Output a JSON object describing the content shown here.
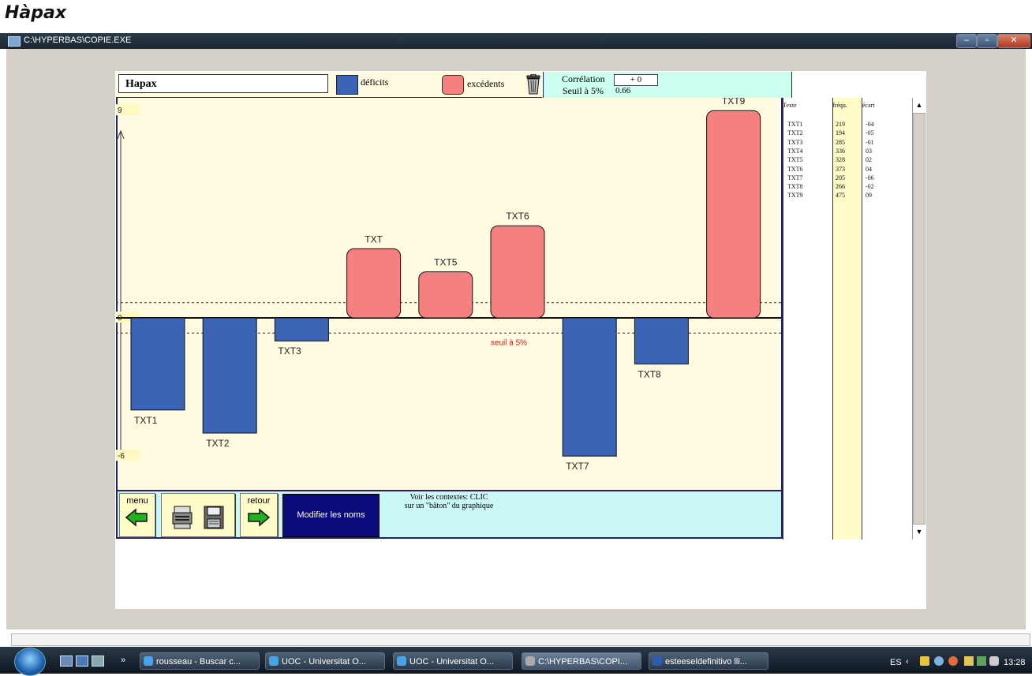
{
  "page_heading": "Hàpax",
  "window": {
    "title": "C:\\HYPERBAS\\COPIE.EXE"
  },
  "header": {
    "name_field": "Hapax",
    "legend_deficit": "déficits",
    "legend_excedent": "excédents",
    "correlation_label": "Corrélation",
    "correlation_value": "+ 0",
    "seuil_label": "Seuil à 5%",
    "seuil_value": "0.66"
  },
  "chart_data": {
    "type": "bar",
    "ylim": [
      -6,
      9
    ],
    "ytick_labels": [
      "9",
      "0",
      "-6"
    ],
    "threshold": 0.66,
    "threshold_label": "seuil à 5%",
    "bars": [
      {
        "label": "TXT1",
        "value": -4
      },
      {
        "label": "TXT2",
        "value": -5
      },
      {
        "label": "TXT3",
        "value": -1
      },
      {
        "label": "TXT",
        "value": 3
      },
      {
        "label": "TXT5",
        "value": 2
      },
      {
        "label": "TXT6",
        "value": 4
      },
      {
        "label": "TXT7",
        "value": -6
      },
      {
        "label": "TXT8",
        "value": -2
      },
      {
        "label": "TXT9",
        "value": 9
      }
    ],
    "colors": {
      "deficit": "#3b64b6",
      "excedent": "#f58080"
    }
  },
  "table": {
    "headers": [
      "Texte",
      "fréqu.",
      "écart"
    ],
    "rows": [
      [
        "TXT1",
        "219",
        "-04"
      ],
      [
        "TXT2",
        "194",
        "-05"
      ],
      [
        "TXT3",
        "285",
        "-01"
      ],
      [
        "TXT4",
        "336",
        "03"
      ],
      [
        "TXT5",
        "328",
        "02"
      ],
      [
        "TXT6",
        "373",
        "04"
      ],
      [
        "TXT7",
        "205",
        "-06"
      ],
      [
        "TXT8",
        "266",
        "-02"
      ],
      [
        "TXT9",
        "475",
        "09"
      ]
    ]
  },
  "footer": {
    "menu_label": "menu",
    "retour_label": "retour",
    "modifier_label": "Modifier les noms",
    "hint_line1": "Voir les contextes: CLIC",
    "hint_line2": "sur un \"bâton\" du graphique"
  },
  "taskbar": {
    "buttons": [
      "rousseau - Buscar c...",
      "UOC - Universitat O...",
      "UOC - Universitat O...",
      "C:\\HYPERBAS\\COPI...",
      "esteeseldefinitivo lli..."
    ],
    "lang": "ES",
    "time": "13:28",
    "chevron": "»"
  }
}
